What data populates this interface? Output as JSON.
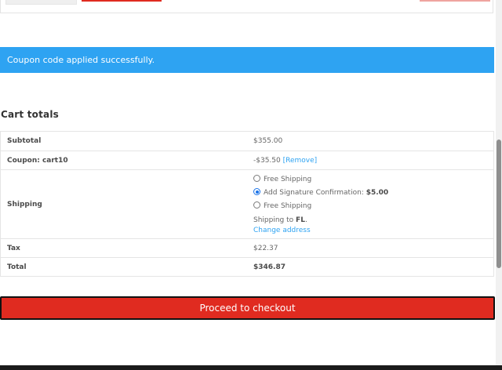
{
  "notice": {
    "text": "Coupon code applied successfully."
  },
  "cart_totals": {
    "title": "Cart totals",
    "subtotal": {
      "label": "Subtotal",
      "value": "$355.00"
    },
    "coupon": {
      "label": "Coupon: cart10",
      "value": "-$35.50",
      "remove_label": "[Remove]"
    },
    "shipping": {
      "label": "Shipping",
      "options": [
        {
          "label": "Free Shipping",
          "price": "",
          "selected": false
        },
        {
          "label": "Add Signature Confirmation:",
          "price": "$5.00",
          "selected": true
        },
        {
          "label": "Free Shipping",
          "price": "",
          "selected": false
        }
      ],
      "shipping_to_prefix": "Shipping to",
      "shipping_to_state": "FL",
      "shipping_to_suffix": ".",
      "change_address": "Change address"
    },
    "tax": {
      "label": "Tax",
      "value": "$22.37"
    },
    "total": {
      "label": "Total",
      "value": "$346.87"
    }
  },
  "checkout": {
    "label": "Proceed to checkout"
  },
  "colors": {
    "accent_red": "#e02b20",
    "notice_blue": "#2ea3f2",
    "link_blue": "#2ea3f2"
  }
}
